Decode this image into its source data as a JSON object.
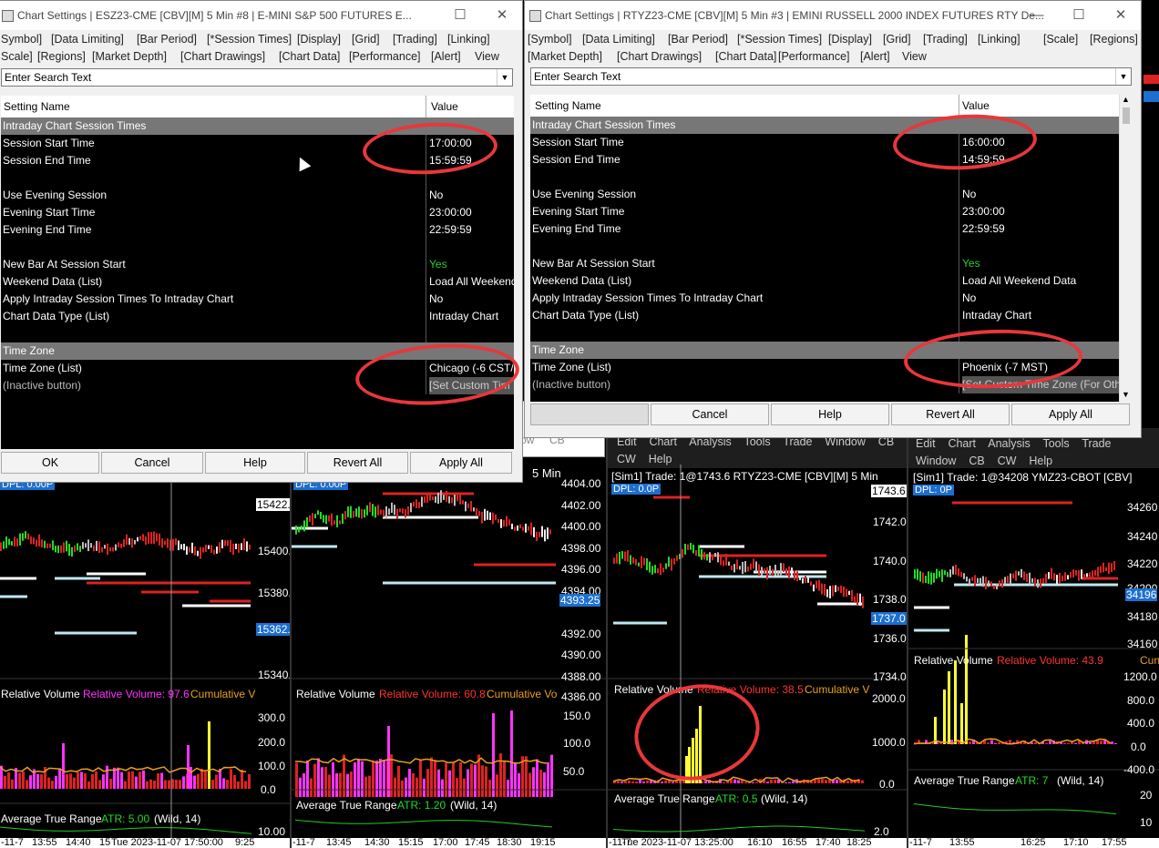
{
  "left_window": {
    "title": "Chart Settings | ESZ23-CME [CBV][M]  5 Min   #8 | E-MINI S&P 500 FUTURES E...",
    "menu_row1": [
      "Symbol]",
      "[Data Limiting]",
      "[Bar Period]",
      "[*Session Times]",
      "[Display]",
      "[Grid]",
      "[Trading]",
      "[Linking]"
    ],
    "menu_row2": [
      "Scale]",
      "[Regions]",
      "[Market Depth]",
      "[Chart Drawings]",
      "[Chart Data]",
      "[Performance]",
      "[Alert]",
      "View"
    ],
    "search_placeholder": "Enter Search Text",
    "col_name": "Setting Name",
    "col_value": "Value",
    "rows": [
      {
        "name": "Intraday Chart Session Times",
        "value": "",
        "type": "section"
      },
      {
        "name": "Session Start Time",
        "value": "17:00:00"
      },
      {
        "name": "Session End Time",
        "value": "15:59:59"
      },
      {
        "name": "",
        "value": ""
      },
      {
        "name": "Use Evening Session",
        "value": "No"
      },
      {
        "name": "Evening Start Time",
        "value": "23:00:00"
      },
      {
        "name": "Evening End Time",
        "value": "22:59:59"
      },
      {
        "name": "",
        "value": ""
      },
      {
        "name": "New Bar At Session Start",
        "value": "Yes",
        "color": "#2ecc2e"
      },
      {
        "name": "Weekend Data (List)",
        "value": "Load All Weekend"
      },
      {
        "name": "Apply Intraday Session Times To Intraday Chart",
        "value": "No"
      },
      {
        "name": "Chart Data Type (List)",
        "value": "Intraday Chart"
      },
      {
        "name": "",
        "value": ""
      },
      {
        "name": "Time Zone",
        "value": "",
        "type": "section"
      },
      {
        "name": "Time Zone (List)",
        "value": "Chicago (-6 CST/"
      },
      {
        "name": " (Inactive button)",
        "value": "[Set Custom Tim",
        "type": "inactive"
      }
    ],
    "buttons": [
      "OK",
      "Cancel",
      "Help",
      "Revert All",
      "Apply All"
    ]
  },
  "right_window": {
    "title": "Chart Settings | RTYZ23-CME [CBV][M]  5 Min   #3 | EMINI RUSSELL 2000 INDEX FUTURES RTY De...",
    "menu_row1": [
      "[Symbol]",
      "[Data Limiting]",
      "[Bar Period]",
      "[*Session Times]",
      "[Display]",
      "[Grid]",
      "[Trading]",
      "[Linking]",
      "[Scale]",
      "[Regions]"
    ],
    "menu_row2": [
      "[Market Depth]",
      "[Chart Drawings]",
      "[Chart Data]",
      "[Performance]",
      "[Alert]",
      "View"
    ],
    "search_placeholder": "Enter Search Text",
    "col_name": "Setting Name",
    "col_value": "Value",
    "rows": [
      {
        "name": "Intraday Chart Session Times",
        "value": "",
        "type": "section"
      },
      {
        "name": "Session Start Time",
        "value": "16:00:00"
      },
      {
        "name": "Session End Time",
        "value": "14:59:59"
      },
      {
        "name": "",
        "value": ""
      },
      {
        "name": "Use Evening Session",
        "value": "No"
      },
      {
        "name": "Evening Start Time",
        "value": "23:00:00"
      },
      {
        "name": "Evening End Time",
        "value": "22:59:59"
      },
      {
        "name": "",
        "value": ""
      },
      {
        "name": "New Bar At Session Start",
        "value": "Yes",
        "color": "#2ecc2e"
      },
      {
        "name": "Weekend Data (List)",
        "value": "Load All Weekend Data"
      },
      {
        "name": "Apply Intraday Session Times To Intraday Chart",
        "value": "No"
      },
      {
        "name": "Chart Data Type (List)",
        "value": "Intraday Chart"
      },
      {
        "name": "",
        "value": ""
      },
      {
        "name": "Time Zone",
        "value": "",
        "type": "section"
      },
      {
        "name": "Time Zone (List)",
        "value": "Phoenix (-7 MST)"
      },
      {
        "name": "(Inactive button)",
        "value": "[Set Custom Time Zone (For Oth",
        "type": "inactive"
      }
    ],
    "buttons": [
      "Cancel",
      "Help",
      "Revert All",
      "Apply All"
    ]
  },
  "mid_window": {
    "menu": [
      "ow",
      "CB"
    ]
  },
  "charts": {
    "pane1": {
      "yticks": [
        "15422.2",
        "15400.0",
        "15380.0",
        "15362.0",
        "15340.0"
      ],
      "price_badge": "15362.0",
      "dpl": "DPL: 0.00P",
      "rv_title": "Relative Volume",
      "rv_value": "Relative Volume: 97.6",
      "rv_cum": "Cumulative V",
      "rv_ticks": [
        "300.0",
        "200.0",
        "100.0",
        "0.0"
      ],
      "atr_title": "Average True Range",
      "atr_value": "ATR: 5.00",
      "atr_wild": "(Wild, 14)",
      "atr_tick": "10.00",
      "time_axis": [
        "-11-7",
        "13:55",
        "14:40",
        "15",
        "Tue 2023-11-07  17:50:00",
        "9:25"
      ]
    },
    "pane2": {
      "header": "5 Min",
      "yticks": [
        "4404.00",
        "4402.00",
        "4400.00",
        "4398.00",
        "4396.00",
        "4394.00",
        "4393.25",
        "4392.00",
        "4390.00",
        "4388.00",
        "4386.00"
      ],
      "price_badge": "4393.25",
      "dpl": "DPL: 0.00P",
      "rv_title": "Relative Volume",
      "rv_value": "Relative Volume: 60.8",
      "rv_cum": "Cumulative Vo",
      "rv_ticks": [
        "150.0",
        "100.0",
        "50.0"
      ],
      "atr_title": "Average True Range",
      "atr_value": "ATR: 1.20",
      "atr_wild": "(Wild, 14)",
      "time_axis": [
        "-11-7",
        "13:45",
        "14:30",
        "15:15",
        "17:00",
        "17:45",
        "18:30",
        "19:15"
      ]
    },
    "pane3": {
      "menu1": [
        "Edit",
        "Chart",
        "Analysis",
        "Tools",
        "Trade",
        "Window",
        "CB"
      ],
      "menu2": [
        "CW",
        "Help"
      ],
      "header": "[Sim1]  Trade: 1@1743.6  RTYZ23-CME [CBV][M]  5 Min",
      "dpl": "DPL: 0.0P",
      "yticks": [
        "1743.6",
        "1742.0",
        "1740.0",
        "1738.0",
        "1737.0",
        "1736.0",
        "1734.0"
      ],
      "price_badge": "1737.0",
      "rv_title": "Relative Volume",
      "rv_value": "Relative Volume: 38.5",
      "rv_cum": "Cumulative V",
      "rv_ticks": [
        "2000.0",
        "1000.0",
        "0.0"
      ],
      "atr_title": "Average True Range",
      "atr_value": "ATR: 0.5",
      "atr_wild": "(Wild, 14)",
      "atr_tick": "2.0",
      "time_axis": [
        "-11-7",
        "Tue 2023-11-07  13:25:00",
        "16:10",
        "16:55",
        "17:40",
        "18:25"
      ]
    },
    "pane4": {
      "menu1": [
        "Edit",
        "Chart",
        "Analysis",
        "Tools",
        "Trade"
      ],
      "menu2": [
        "Window",
        "CB",
        "CW",
        "Help"
      ],
      "header": "[Sim1]  Trade: 1@34208  YMZ23-CBOT [CBV]",
      "dpl": "DPL: 0P",
      "yticks": [
        "34260",
        "34240",
        "34220",
        "34200",
        "34196",
        "34180",
        "34160"
      ],
      "price_badge": "34196",
      "rv_title": "Relative Volume",
      "rv_value": "Relative Volume: 43.9",
      "rv_cum": "Cun",
      "rv_ticks": [
        "1200.0",
        "800.0",
        "400.0",
        "0.0",
        "-400.0"
      ],
      "atr_title": "Average True Range",
      "atr_value": "ATR: 7",
      "atr_wild": "(Wild, 14)",
      "atr_ticks": [
        "20",
        "10"
      ],
      "time_axis": [
        "-11-7",
        "13:55",
        "16:25",
        "17:10",
        "17:55"
      ]
    }
  },
  "colors": {
    "annotation": "#e8373a",
    "green_value": "#2ecc2e",
    "rv_magenta": "#ff33ff",
    "atr_green": "#22dd22",
    "badge_blue": "#1c6fd0"
  }
}
